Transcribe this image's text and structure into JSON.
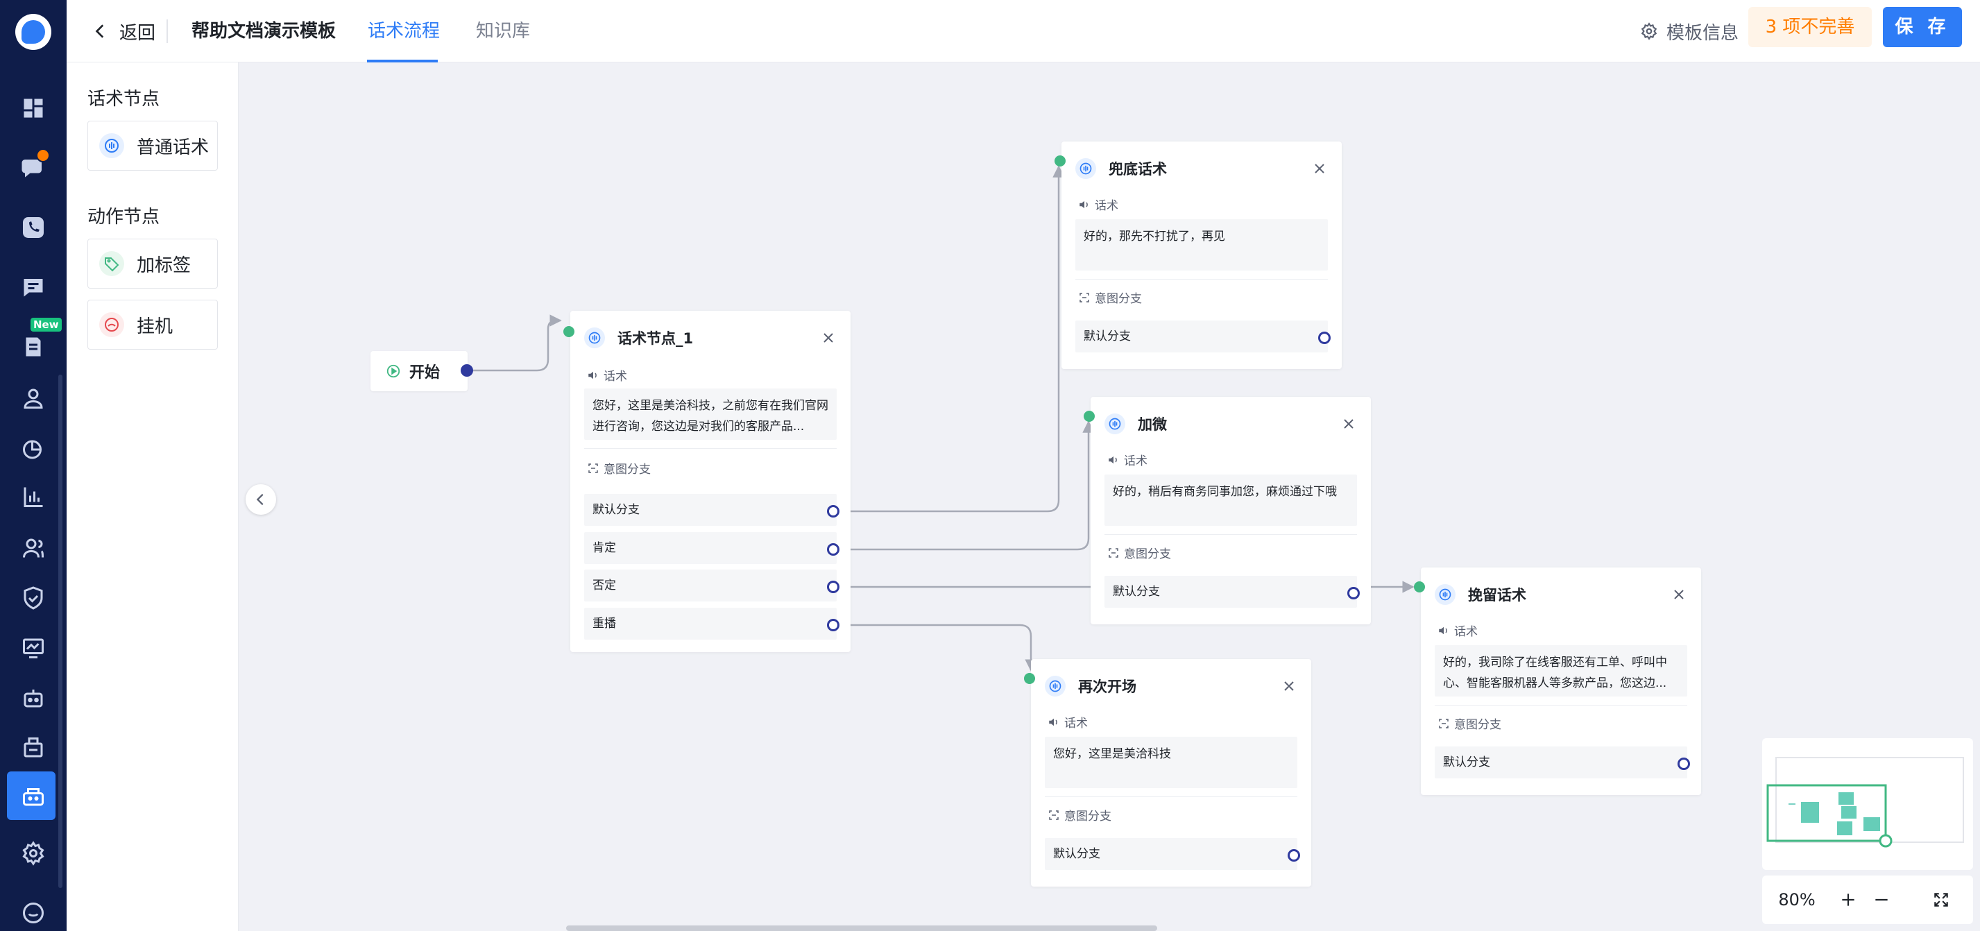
{
  "rail": {
    "icons": [
      "dashboard-icon",
      "chat-icon",
      "phone-icon",
      "message-icon",
      "ticket-icon",
      "user-icon",
      "analytics-icon",
      "stats-icon",
      "team-icon",
      "shield-icon",
      "monitor-icon",
      "robot-icon",
      "mailbox-icon",
      "call-bot-icon",
      "settings-icon",
      "feedback-icon"
    ],
    "new_badge": "New",
    "accent": "#2e7cf6",
    "background": "#0f1d4a"
  },
  "topbar": {
    "back_label": "返回",
    "template_title": "帮助文档演示模板",
    "tabs": [
      {
        "label": "话术流程",
        "active": true
      },
      {
        "label": "知识库",
        "active": false
      }
    ],
    "template_info_label": "模板信息",
    "incomplete_label": "3 项不完善",
    "save_label": "保 存"
  },
  "palette": {
    "speech_heading": "话术节点",
    "speech_items": [
      {
        "label": "普通话术",
        "icon": "speech-icon"
      }
    ],
    "action_heading": "动作节点",
    "action_items": [
      {
        "label": "加标签",
        "icon": "tag-icon"
      },
      {
        "label": "挂机",
        "icon": "hangup-icon"
      }
    ]
  },
  "canvas": {
    "start_label": "开始",
    "section_speech": "话术",
    "section_intent": "意图分支",
    "nodes": {
      "n1": {
        "title": "话术节点_1",
        "speech": "您好，这里是美洽科技，之前您有在我们官网进行咨询，您这边是对我们的客服产品...",
        "branches": [
          "默认分支",
          "肯定",
          "否定",
          "重播"
        ]
      },
      "fallback": {
        "title": "兜底话术",
        "speech": "好的，那先不打扰了，再见",
        "branches": [
          "默认分支"
        ]
      },
      "wechat": {
        "title": "加微",
        "speech": "好的，稍后有商务同事加您，麻烦通过下哦",
        "branches": [
          "默认分支"
        ]
      },
      "retain": {
        "title": "挽留话术",
        "speech": "好的，我司除了在线客服还有工单、呼叫中心、智能客服机器人等多款产品，您这边...",
        "branches": [
          "默认分支"
        ]
      },
      "reopen": {
        "title": "再次开场",
        "speech": "您好，这里是美洽科技",
        "branches": [
          "默认分支"
        ]
      }
    }
  },
  "zoom": {
    "level": "80%"
  }
}
